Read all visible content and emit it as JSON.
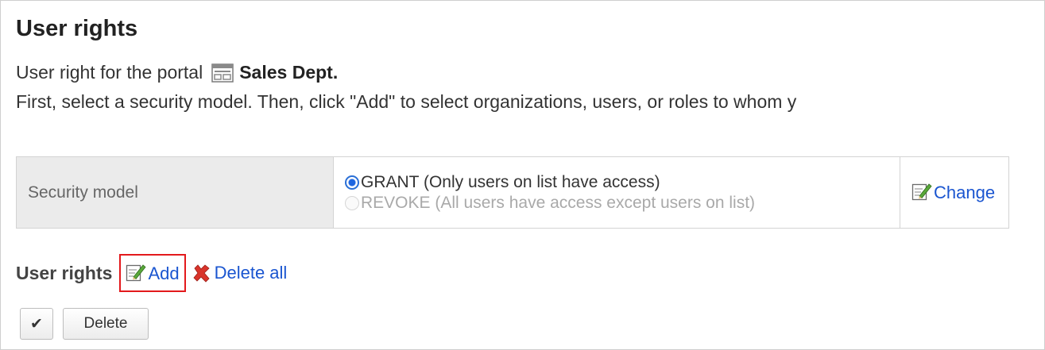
{
  "page": {
    "title": "User rights",
    "portal_prefix": "User right for the portal",
    "portal_name": "Sales Dept.",
    "instruction": "First, select a security model. Then, click \"Add\" to select organizations, users, or roles to whom y"
  },
  "security_model": {
    "label": "Security model",
    "options": [
      {
        "label": "GRANT (Only users on list have access)",
        "selected": true
      },
      {
        "label": "REVOKE (All users have access except users on list)",
        "selected": false
      }
    ],
    "change_label": "Change"
  },
  "user_rights": {
    "label": "User rights",
    "add_label": "Add",
    "delete_all_label": "Delete all",
    "check_button_label": "✔",
    "delete_button_label": "Delete"
  },
  "colors": {
    "link": "#1a55d0",
    "highlight_border": "#e3191c",
    "delete_icon": "#d9342b"
  },
  "icons": {
    "portal": "portal-icon",
    "change": "edit-icon",
    "add": "edit-icon",
    "delete_all": "x-delete-icon",
    "check": "checkmark-icon"
  }
}
